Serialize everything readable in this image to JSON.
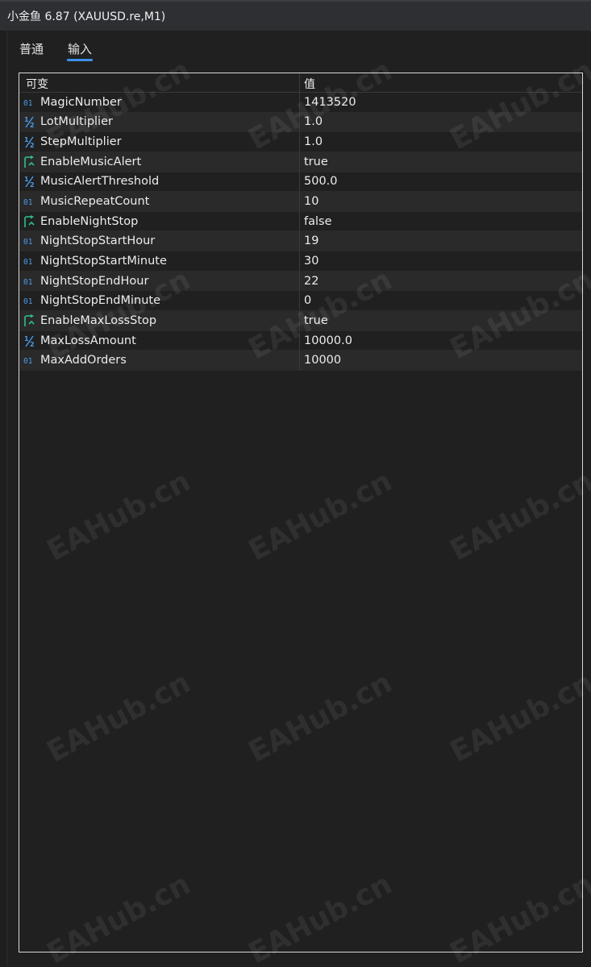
{
  "window": {
    "title": "小金鱼 6.87 (XAUUSD.re,M1)"
  },
  "tabs": [
    {
      "label": "普通",
      "active": false
    },
    {
      "label": "输入",
      "active": true
    }
  ],
  "grid": {
    "columns": {
      "name": "可变",
      "value": "值"
    },
    "rows": [
      {
        "icon": "int-icon",
        "name": "MagicNumber",
        "value": "1413520"
      },
      {
        "icon": "double-icon",
        "name": "LotMultiplier",
        "value": "1.0"
      },
      {
        "icon": "double-icon",
        "name": "StepMultiplier",
        "value": "1.0"
      },
      {
        "icon": "bool-icon",
        "name": "EnableMusicAlert",
        "value": "true"
      },
      {
        "icon": "double-icon",
        "name": "MusicAlertThreshold",
        "value": "500.0"
      },
      {
        "icon": "int-icon",
        "name": "MusicRepeatCount",
        "value": "10"
      },
      {
        "icon": "bool-icon",
        "name": "EnableNightStop",
        "value": "false"
      },
      {
        "icon": "int-icon",
        "name": "NightStopStartHour",
        "value": "19"
      },
      {
        "icon": "int-icon",
        "name": "NightStopStartMinute",
        "value": "30"
      },
      {
        "icon": "int-icon",
        "name": "NightStopEndHour",
        "value": "22"
      },
      {
        "icon": "int-icon",
        "name": "NightStopEndMinute",
        "value": "0"
      },
      {
        "icon": "bool-icon",
        "name": "EnableMaxLossStop",
        "value": "true"
      },
      {
        "icon": "double-icon",
        "name": "MaxLossAmount",
        "value": "10000.0"
      },
      {
        "icon": "int-icon",
        "name": "MaxAddOrders",
        "value": "10000"
      }
    ]
  },
  "watermark": "EAHub.cn",
  "colors": {
    "accent": "#3c8fe8",
    "int_icon": "#4a9be8",
    "bool_icon": "#2fbf8f"
  }
}
